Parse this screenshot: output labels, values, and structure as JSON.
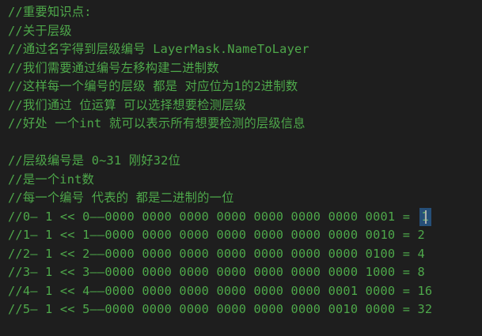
{
  "editor": {
    "colors": {
      "background": "#1e1e1e",
      "comment": "#4ea84a",
      "selection": "#264f78",
      "caret": "#aeafad"
    },
    "lines": [
      "//重要知识点:",
      "//关于层级",
      "//通过名字得到层级编号 LayerMask.NameToLayer",
      "//我们需要通过编号左移构建二进制数",
      "//这样每一个编号的层级 都是 对应位为1的2进制数",
      "//我们通过 位运算 可以选择想要检测层级",
      "//好处 一个int 就可以表示所有想要检测的层级信息",
      "",
      "//层级编号是 0~31 刚好32位",
      "//是一个int数",
      "//每一个编号 代表的 都是二进制的一位",
      "//0— 1 << 0——0000 0000 0000 0000 0000 0000 0000 0001 =",
      "//1— 1 << 1——0000 0000 0000 0000 0000 0000 0000 0010 = 2",
      "//2— 1 << 2——0000 0000 0000 0000 0000 0000 0000 0100 = 4",
      "//3— 1 << 3——0000 0000 0000 0000 0000 0000 0000 1000 = 8",
      "//4— 1 << 4——0000 0000 0000 0000 0000 0000 0001 0000 = 16",
      "//5— 1 << 5——0000 0000 0000 0000 0000 0000 0010 0000 = 32"
    ],
    "cursor_value": "1"
  }
}
